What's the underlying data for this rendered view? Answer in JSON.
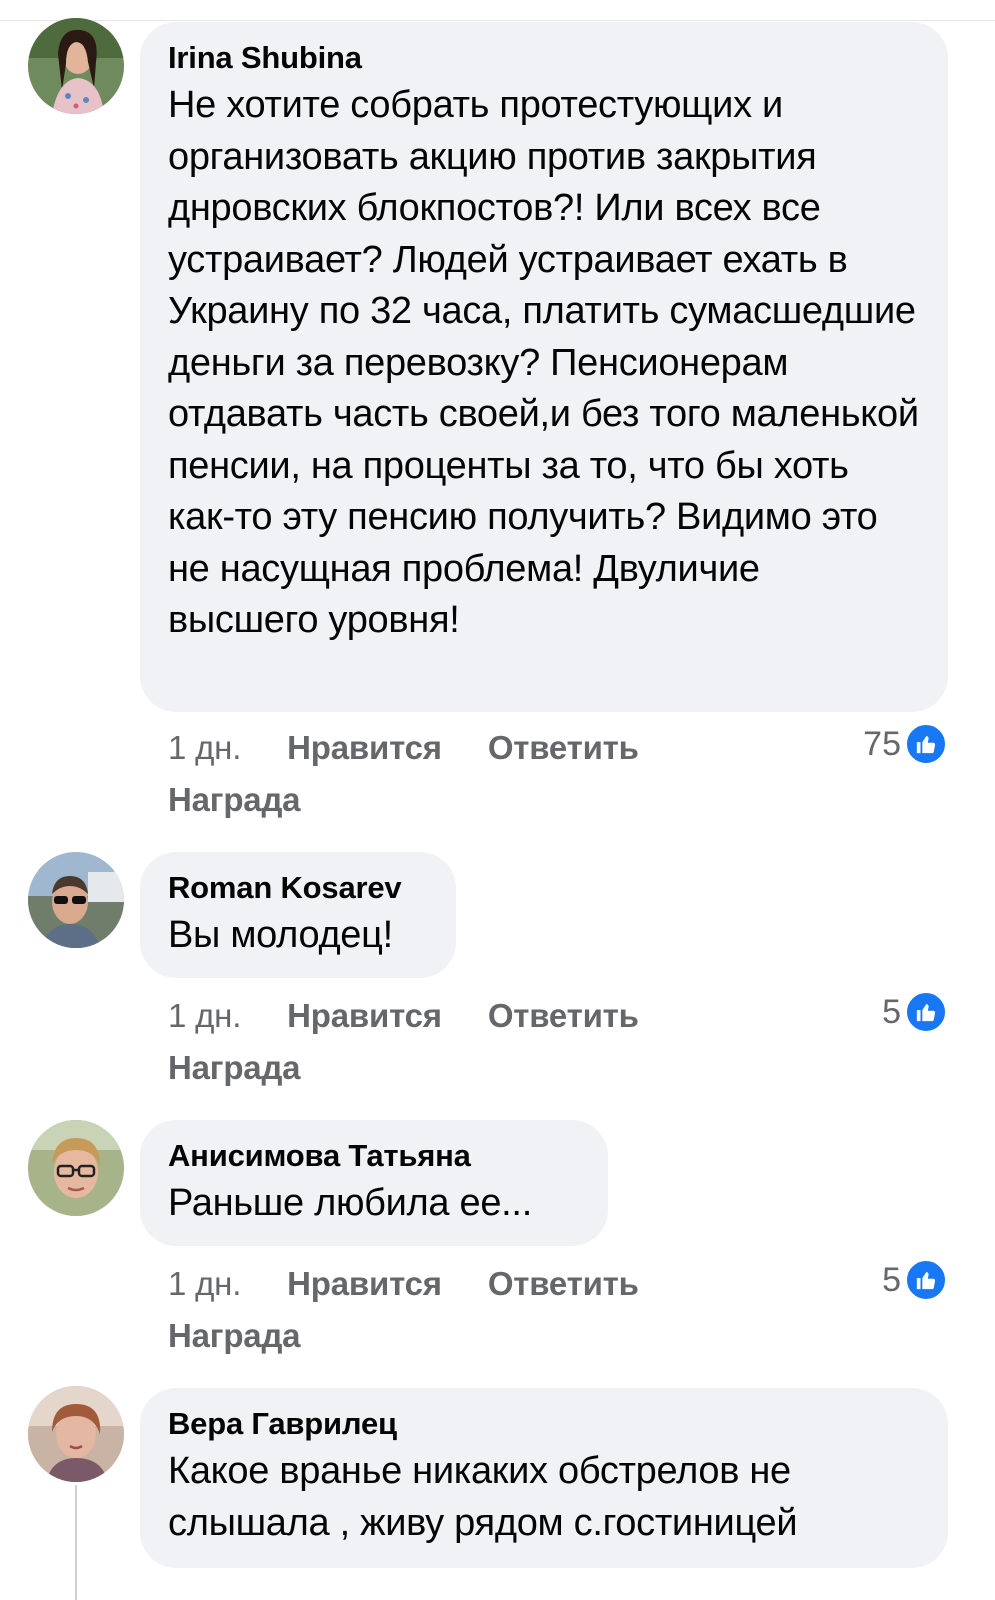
{
  "comments": [
    {
      "author": "Irina Shubina",
      "text": "Не хотите собрать протестующих и организовать акцию против закрытия днровских блокпостов?! Или всех все устраивает? Людей устраивает ехать в Украину по 32 часа, платить сумасшедшие деньги за перевозку? Пенсионерам отдавать часть своей,и без того маленькой пенсии, на проценты за то, что бы хоть как-то эту пенсию получить? Видимо это не насущная проблема! Двуличие высшего уровня!",
      "time": "1 дн.",
      "like_label": "Нравится",
      "reply_label": "Ответить",
      "award_label": "Награда",
      "reaction_count": "75",
      "reaction_icon": "like-icon"
    },
    {
      "author": "Roman Kosarev",
      "text": "Вы молодец!",
      "time": "1 дн.",
      "like_label": "Нравится",
      "reply_label": "Ответить",
      "award_label": "Награда",
      "reaction_count": "5",
      "reaction_icon": "like-icon"
    },
    {
      "author": "Анисимова Татьяна",
      "text": "Раньше любила ее...",
      "time": "1 дн.",
      "like_label": "Нравится",
      "reply_label": "Ответить",
      "award_label": "Награда",
      "reaction_count": "5",
      "reaction_icon": "like-icon"
    },
    {
      "author": "Вера Гаврилец",
      "text": "Какое вранье никаких обстрелов не слышала , живу рядом с.гостиницей"
    }
  ],
  "colors": {
    "bubble": "#f0f2f5",
    "secondary_text": "#65676b",
    "like_blue": "#1877f2"
  }
}
